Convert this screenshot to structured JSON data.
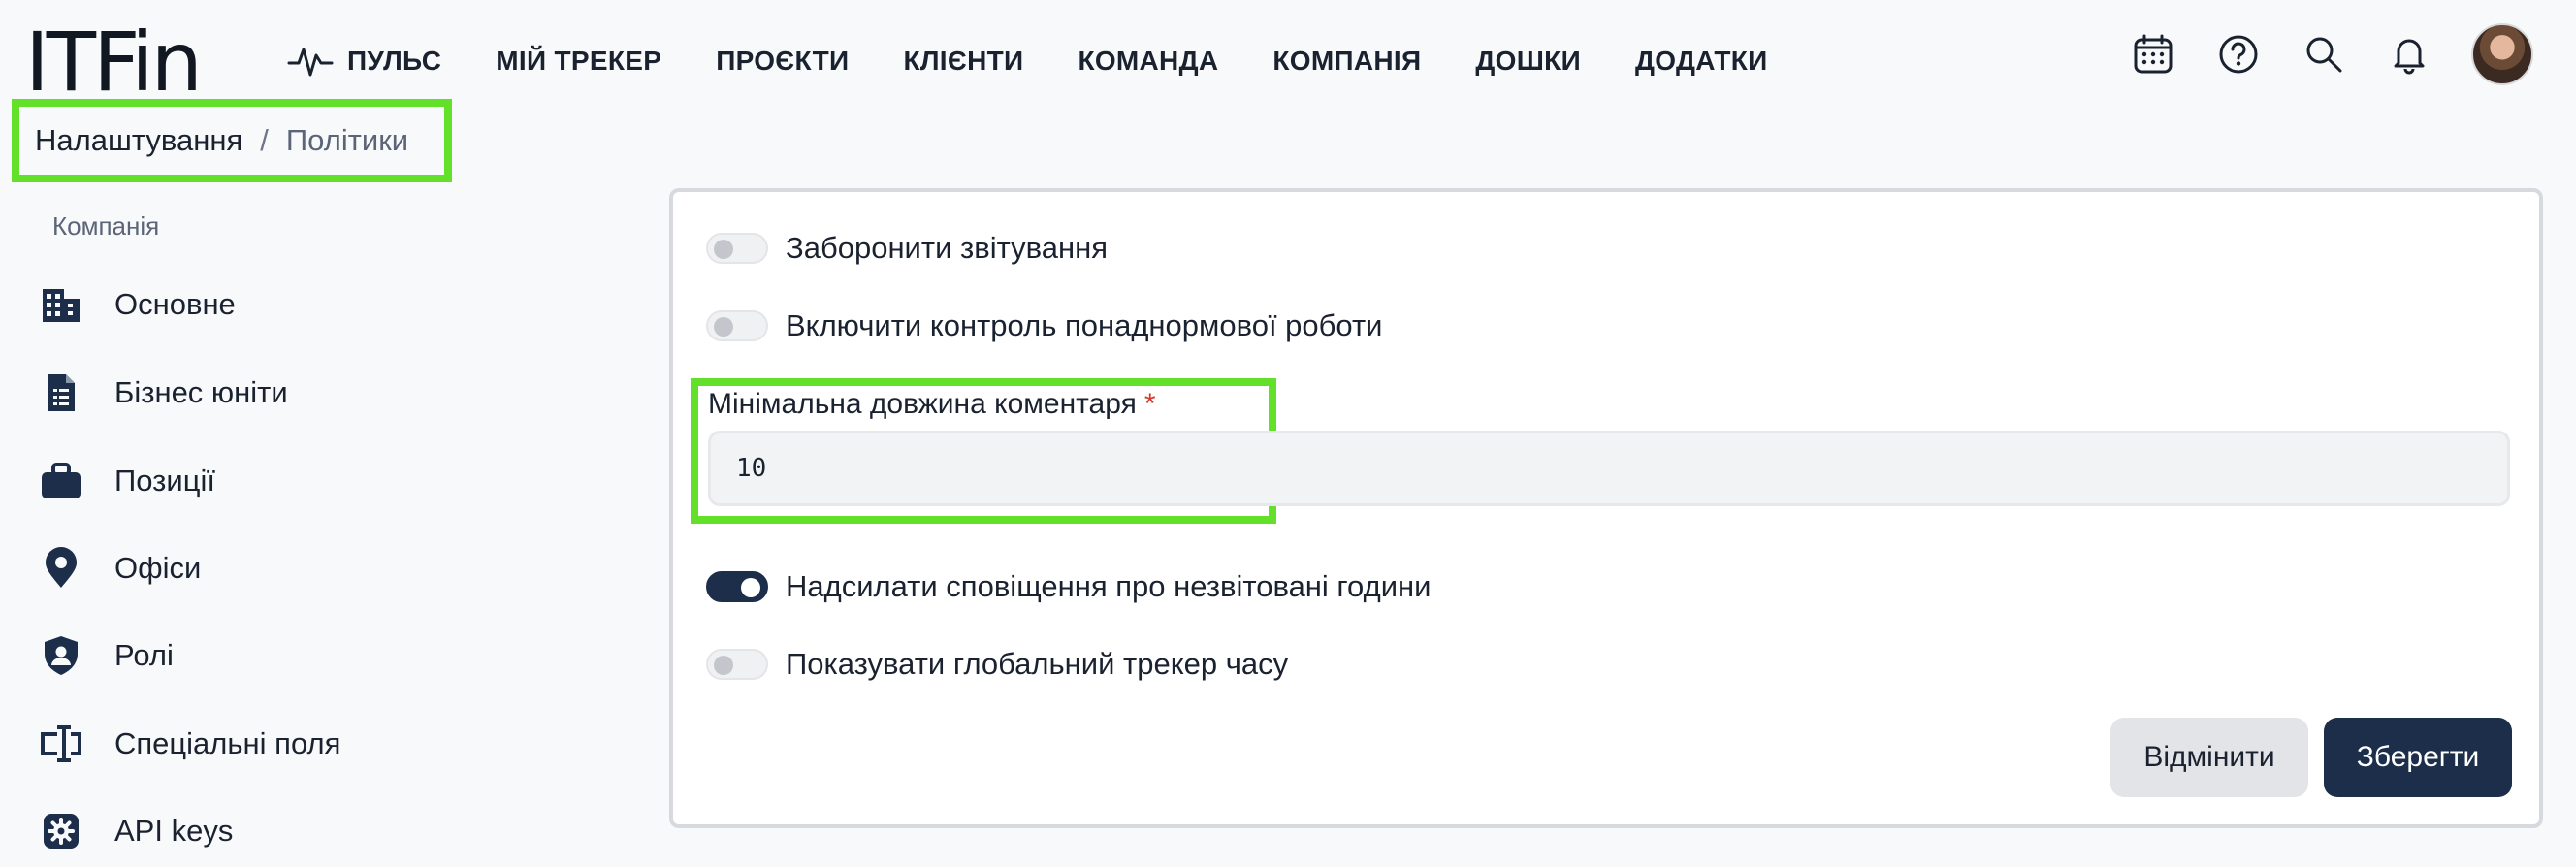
{
  "header": {
    "logo": "ITFin",
    "nav": [
      {
        "label": "ПУЛЬС",
        "icon": "pulse-icon"
      },
      {
        "label": "МІЙ ТРЕКЕР"
      },
      {
        "label": "ПРОЄКТИ"
      },
      {
        "label": "КЛІЄНТИ"
      },
      {
        "label": "КОМАНДА"
      },
      {
        "label": "КОМПАНІЯ"
      },
      {
        "label": "ДОШКИ"
      },
      {
        "label": "ДОДАТКИ"
      }
    ],
    "icons": [
      "calendar-icon",
      "help-icon",
      "search-icon",
      "bell-icon"
    ]
  },
  "breadcrumb": {
    "first": "Налаштування",
    "separator": "/",
    "current": "Політики"
  },
  "sidebar": {
    "section_title": "Компанія",
    "items": [
      {
        "label": "Основне",
        "icon": "building-icon"
      },
      {
        "label": "Бізнес юніти",
        "icon": "document-icon"
      },
      {
        "label": "Позиції",
        "icon": "briefcase-icon"
      },
      {
        "label": "Офіси",
        "icon": "location-pin-icon"
      },
      {
        "label": "Ролі",
        "icon": "shield-user-icon"
      },
      {
        "label": "Спеціальні поля",
        "icon": "input-field-icon"
      },
      {
        "label": "API keys",
        "icon": "gear-icon"
      }
    ]
  },
  "policies": {
    "toggles": [
      {
        "label": "Заборонити звітування",
        "on": false
      },
      {
        "label": "Включити контроль понаднормової роботи",
        "on": false
      },
      {
        "label": "Надсилати сповіщення про незвітовані години",
        "on": true
      },
      {
        "label": "Показувати глобальний трекер часу",
        "on": false
      }
    ],
    "min_comment": {
      "label": "Мінімальна довжина коментаря",
      "required_mark": "*",
      "value": "10"
    },
    "cancel_label": "Відмінити",
    "save_label": "Зберегти"
  },
  "colors": {
    "accent": "#1c2e4a",
    "highlight": "#62e02a",
    "required": "#d33a2c"
  }
}
